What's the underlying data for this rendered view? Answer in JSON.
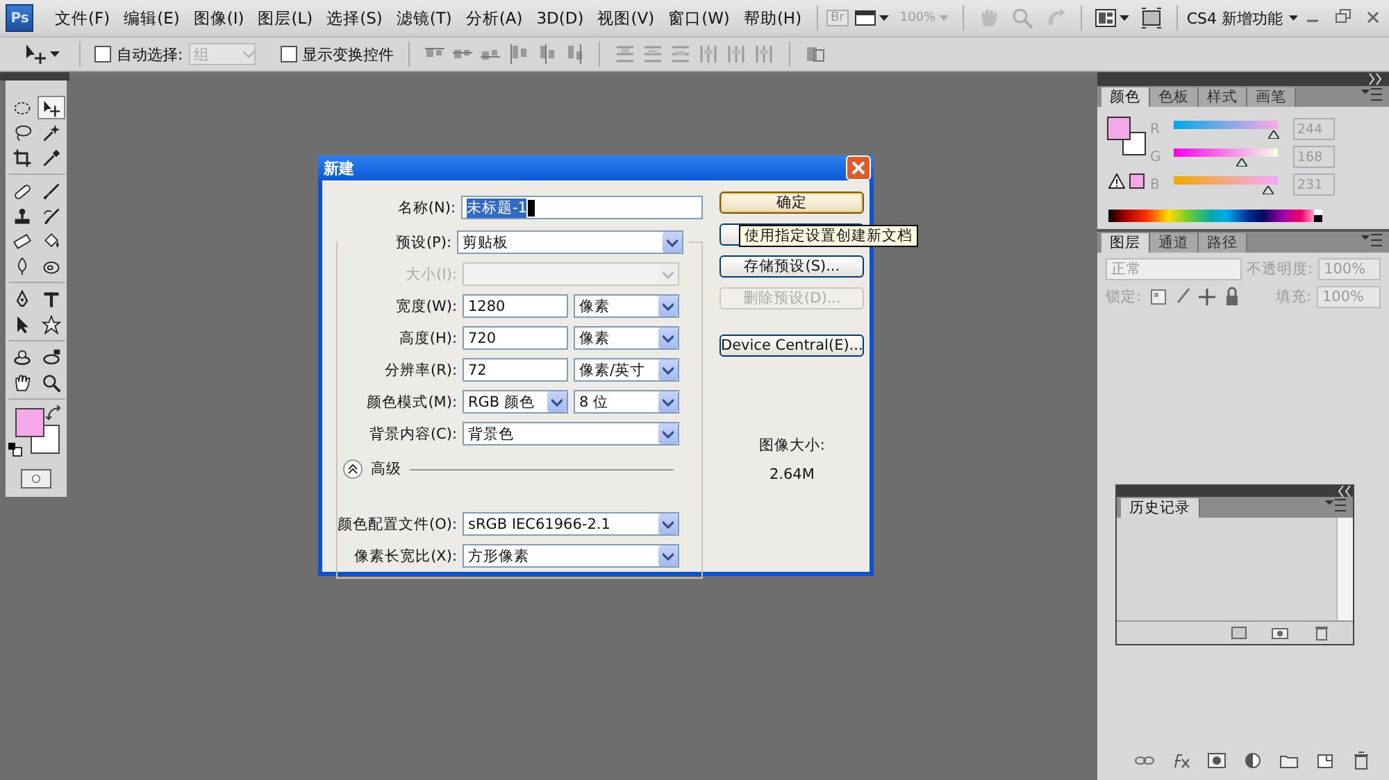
{
  "menu_bar": {
    "logo": "Ps",
    "items": [
      "文件(F)",
      "编辑(E)",
      "图像(I)",
      "图层(L)",
      "选择(S)",
      "滤镜(T)",
      "分析(A)",
      "3D(D)",
      "视图(V)",
      "窗口(W)",
      "帮助(H)"
    ],
    "bridge": "Br",
    "zoom": "100%",
    "workspace": "CS4 新增功能"
  },
  "options_bar": {
    "auto_select": {
      "label": "自动选择:",
      "checked": false
    },
    "auto_select_target": {
      "value": "组",
      "disabled": true
    },
    "show_transform": {
      "label": "显示变换控件",
      "checked": false
    }
  },
  "toolbox": {
    "tool_groups": [
      {
        "tools": [
          {
            "kind": "marquee",
            "selected": false
          },
          {
            "kind": "move",
            "selected": true
          },
          {
            "kind": "lasso",
            "selected": false
          },
          {
            "kind": "wand",
            "selected": false
          },
          {
            "kind": "crop",
            "selected": false
          },
          {
            "kind": "eyedropper",
            "selected": false
          }
        ]
      },
      {
        "tools": [
          {
            "kind": "bandage",
            "selected": false
          },
          {
            "kind": "brush",
            "selected": false
          },
          {
            "kind": "stamp",
            "selected": false
          },
          {
            "kind": "history_brush",
            "selected": false
          },
          {
            "kind": "eraser",
            "selected": false
          },
          {
            "kind": "bucket",
            "selected": false
          },
          {
            "kind": "drop",
            "selected": false
          },
          {
            "kind": "sponge",
            "selected": false
          }
        ]
      },
      {
        "tools": [
          {
            "kind": "pen",
            "selected": false
          },
          {
            "kind": "type",
            "selected": false
          },
          {
            "kind": "pointer",
            "selected": false
          },
          {
            "kind": "shape",
            "selected": false
          }
        ]
      },
      {
        "tools": [
          {
            "kind": "rotate",
            "selected": false
          },
          {
            "kind": "orbit",
            "selected": false
          },
          {
            "kind": "hand",
            "selected": false
          },
          {
            "kind": "zoom",
            "selected": false
          }
        ]
      }
    ],
    "swatches": [
      {
        "kind": "foreground",
        "color": "#f4a8e7"
      },
      {
        "kind": "background",
        "color": "#ffffff"
      }
    ]
  },
  "dialog": {
    "title": "新建",
    "name_field": {
      "label": "名称(N):",
      "value": "未标题-1",
      "highlighted": true
    },
    "preset": {
      "label": "预设(P):",
      "value": "剪贴板"
    },
    "rows": [
      {
        "kind": "select",
        "label": "大小(I):",
        "disabled": true
      },
      {
        "kind": "number",
        "label": "宽度(W):",
        "value": "1280",
        "unit": "像素",
        "disabled": false
      },
      {
        "kind": "number",
        "label": "高度(H):",
        "value": "720",
        "unit": "像素",
        "disabled": false
      },
      {
        "kind": "number",
        "label": "分辨率(R):",
        "value": "72",
        "unit": "像素/英寸",
        "disabled": false
      },
      {
        "kind": "dual_select",
        "label": "颜色模式(M):",
        "value": "RGB 颜色",
        "unit": "8 位",
        "disabled": false
      },
      {
        "kind": "select",
        "label": "背景内容(C):",
        "value": "背景色",
        "disabled": false
      }
    ],
    "advanced": {
      "label": "高级",
      "expanded": true,
      "rows": [
        {
          "kind": "select",
          "label": "颜色配置文件(O):",
          "value": "sRGB IEC61966-2.1",
          "disabled": false
        },
        {
          "kind": "select",
          "label": "像素长宽比(X):",
          "value": "方形像素",
          "disabled": false
        }
      ]
    },
    "buttons": [
      {
        "label": "确定",
        "default": true,
        "disabled": false
      },
      {
        "default": false,
        "disabled": false
      },
      {
        "label": "存储预设(S)...",
        "default": false,
        "disabled": false
      },
      {
        "label": "删除预设(D)...",
        "default": false,
        "disabled": true
      },
      {
        "label": "Device Central(E)...",
        "default": false,
        "disabled": false
      }
    ],
    "tooltip": "使用指定设置创建新文档",
    "image_size": {
      "label": "图像大小:",
      "value": "2.64M"
    }
  },
  "color_panel": {
    "tabs": [
      {
        "label": "颜色",
        "selected": true
      },
      {
        "label": "色板",
        "selected": false
      },
      {
        "label": "样式",
        "selected": false
      },
      {
        "label": "画笔",
        "selected": false
      }
    ],
    "channels": [
      {
        "name": "R",
        "level": 0.957,
        "reading": "244"
      },
      {
        "name": "G",
        "level": 0.659,
        "reading": "168"
      },
      {
        "name": "B",
        "level": 0.906,
        "reading": "231"
      }
    ]
  },
  "layers_panel": {
    "tabs": [
      {
        "label": "图层",
        "selected": true
      },
      {
        "label": "通道",
        "selected": false
      },
      {
        "label": "路径",
        "selected": false
      }
    ],
    "disabled": true,
    "blend_mode": "正常",
    "opacity_label": "不透明度:",
    "opacity": "100%",
    "lock_label": "锁定:",
    "fill_label": "填充:",
    "fill": "100%"
  },
  "history_panel": {
    "tabs": [
      {
        "label": "历史记录",
        "selected": true
      }
    ]
  }
}
